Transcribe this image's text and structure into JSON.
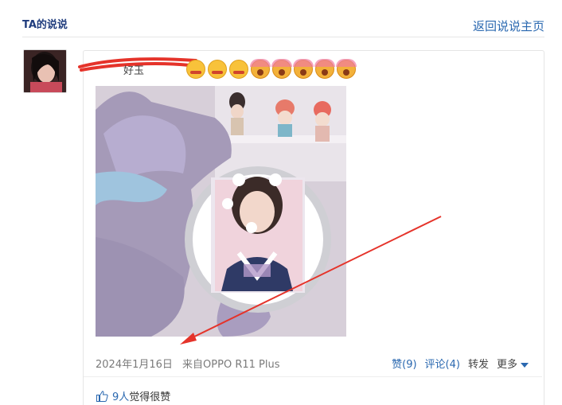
{
  "header": {
    "title": "TA的说说",
    "back_link": "返回说说主页"
  },
  "post": {
    "text_visible_fragment": "好玉",
    "emojis": [
      "sleepy-face-icon",
      "sleepy-face-icon",
      "sleepy-face-icon",
      "scream-face-icon",
      "scream-face-icon",
      "scream-face-icon",
      "scream-face-icon",
      "scream-face-icon"
    ],
    "date": "2024年1月16日",
    "source": "来自OPPO R11 Plus",
    "actions": {
      "like": "赞(9)",
      "comment": "评论(4)",
      "share": "转发",
      "more": "更多"
    },
    "likes": {
      "count": "9人",
      "text": "觉得很赞"
    }
  },
  "colors": {
    "link": "#2a68b0",
    "title": "#1f3c7d",
    "annotation": "#e5332a"
  }
}
